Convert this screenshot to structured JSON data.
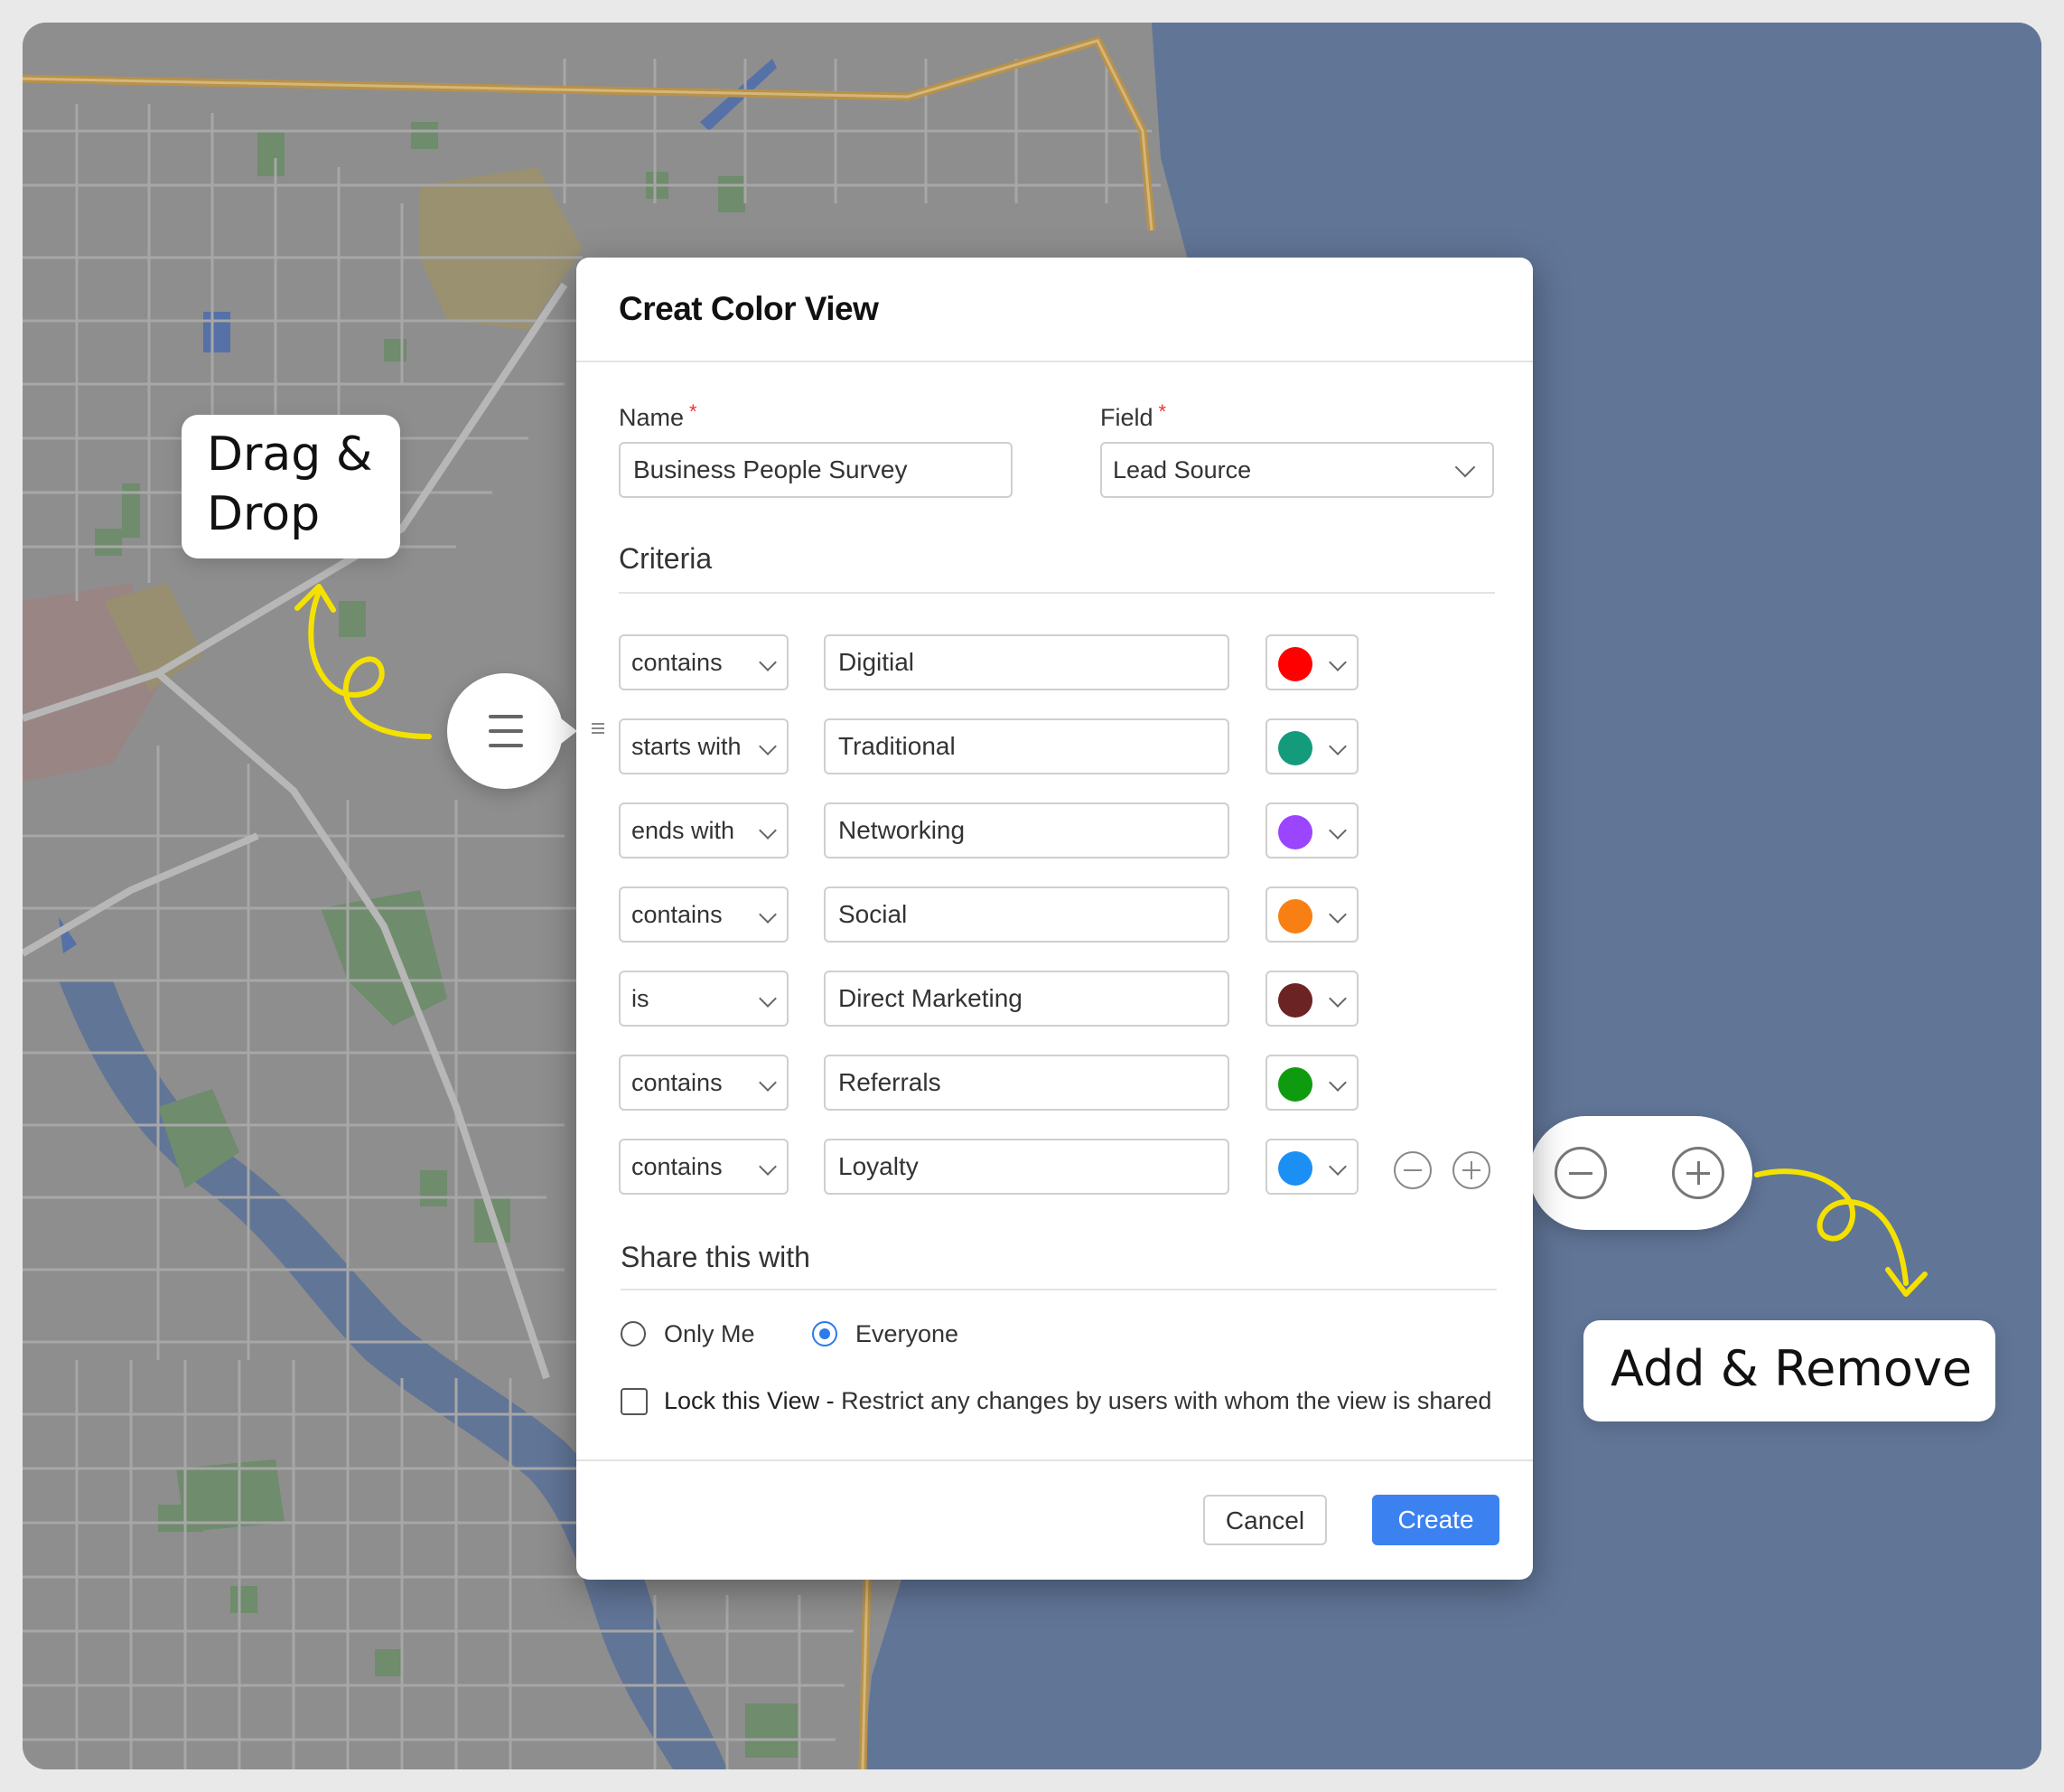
{
  "modal": {
    "title": "Creat Color View",
    "name_label": "Name",
    "name_value": "Business People Survey",
    "field_label": "Field",
    "field_value": "Lead Source",
    "required_mark": "*",
    "criteria_heading": "Criteria",
    "criteria": [
      {
        "operator": "contains",
        "value": "Digitial",
        "color": "#ff0000"
      },
      {
        "operator": "starts with",
        "value": "Traditional",
        "color": "#139b7c"
      },
      {
        "operator": "ends with",
        "value": "Networking",
        "color": "#9b45ff"
      },
      {
        "operator": "contains",
        "value": "Social",
        "color": "#f77f14"
      },
      {
        "operator": "is",
        "value": "Direct Marketing",
        "color": "#6b2323"
      },
      {
        "operator": "contains",
        "value": "Referrals",
        "color": "#0f9b0f"
      },
      {
        "operator": "contains",
        "value": "Loyalty",
        "color": "#1c8ff5"
      }
    ],
    "share_heading": "Share this with",
    "share_options": [
      {
        "label": "Only Me",
        "selected": false
      },
      {
        "label": "Everyone",
        "selected": true
      }
    ],
    "lock_label_bold": "Lock this View -",
    "lock_label_rest": "Restrict any changes by users with whom the view is shared",
    "lock_checked": false,
    "cancel_label": "Cancel",
    "create_label": "Create"
  },
  "callouts": {
    "drag_drop_line1": "Drag &",
    "drag_drop_line2": "Drop",
    "add_remove": "Add & Remove"
  },
  "colors": {
    "primary": "#3b82f0",
    "required": "#e33333",
    "annotation_arrow": "#f5e100",
    "map_water": "#617597",
    "map_land": "#8e8e8e",
    "map_park": "#6f8c6c",
    "map_highway": "#b8924a"
  }
}
